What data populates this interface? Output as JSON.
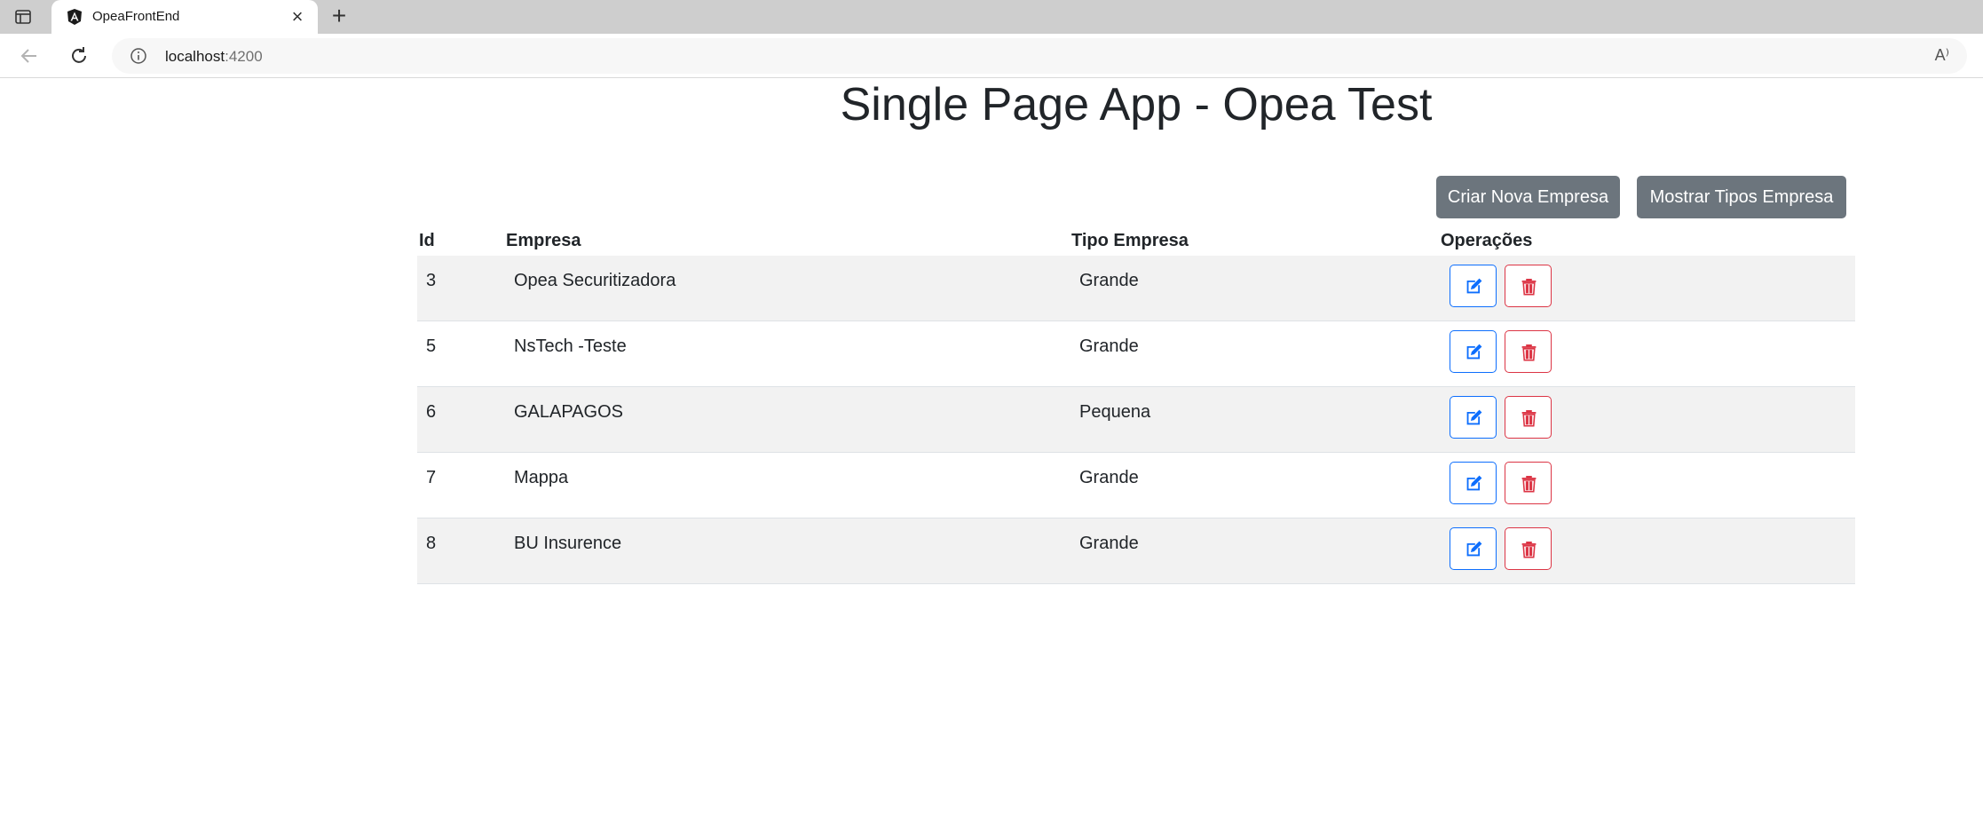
{
  "browser": {
    "tab_title": "OpeaFrontEnd",
    "url_host": "localhost",
    "url_port": ":4200",
    "read_aloud": "A⁾"
  },
  "page": {
    "title": "Single Page App - Opea Test",
    "buttons": {
      "create": "Criar Nova Empresa",
      "show_types": "Mostrar Tipos Empresa"
    },
    "table": {
      "headers": {
        "id": "Id",
        "empresa": "Empresa",
        "tipo": "Tipo Empresa",
        "ops": "Operações"
      },
      "rows": [
        {
          "id": "3",
          "empresa": "Opea Securitizadora",
          "tipo": "Grande"
        },
        {
          "id": "5",
          "empresa": "NsTech -Teste",
          "tipo": "Grande"
        },
        {
          "id": "6",
          "empresa": "GALAPAGOS",
          "tipo": "Pequena"
        },
        {
          "id": "7",
          "empresa": "Mappa",
          "tipo": "Grande"
        },
        {
          "id": "8",
          "empresa": "BU Insurence",
          "tipo": "Grande"
        }
      ]
    }
  },
  "colors": {
    "secondary": "#6c757d",
    "primary": "#0d6efd",
    "danger": "#dc3545",
    "stripe": "#f2f2f2"
  }
}
